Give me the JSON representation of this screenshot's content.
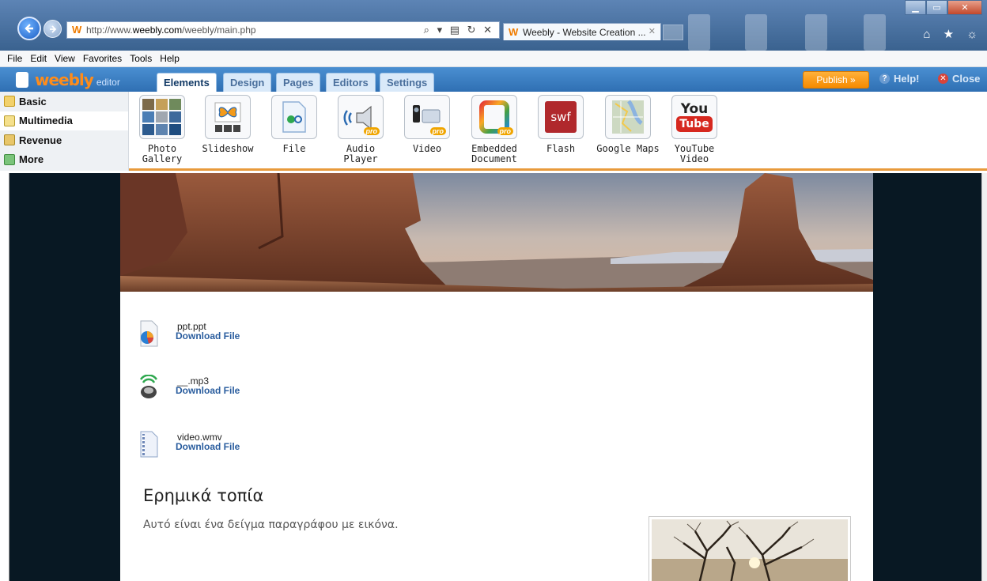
{
  "browser": {
    "url_prefix": "http://www.",
    "url_host": "weebly.com",
    "url_path": "/weebly/main.php",
    "address_tools": "⌕ ▾ ▤ ↻ ✕",
    "tab_title": "Weebly - Website Creation ...",
    "tab_close": "✕",
    "win_minimize": "▁",
    "win_maximize": "▭",
    "win_close": "✕",
    "chrome_icons": "⌂ ★ ☼"
  },
  "menubar": [
    "File",
    "Edit",
    "View",
    "Favorites",
    "Tools",
    "Help"
  ],
  "editor": {
    "logo": "weebly",
    "logo_sub": "editor",
    "tabs": [
      "Elements",
      "Design",
      "Pages",
      "Editors",
      "Settings"
    ],
    "publish": "Publish »",
    "help": "Help!",
    "close": "Close"
  },
  "categories": [
    "Basic",
    "Multimedia",
    "Revenue",
    "More"
  ],
  "elements": [
    {
      "label": "Photo\nGallery",
      "icon": "photo-gallery-icon"
    },
    {
      "label": "Slideshow",
      "icon": "slideshow-icon"
    },
    {
      "label": "File",
      "icon": "file-icon"
    },
    {
      "label": "Audio\nPlayer",
      "icon": "audio-player-icon",
      "pro": true
    },
    {
      "label": "Video",
      "icon": "video-icon",
      "pro": true
    },
    {
      "label": "Embedded\nDocument",
      "icon": "embedded-document-icon",
      "pro": true
    },
    {
      "label": "Flash",
      "icon": "flash-icon"
    },
    {
      "label": "Google Maps",
      "icon": "google-maps-icon"
    },
    {
      "label": "YouTube\nVideo",
      "icon": "youtube-icon"
    }
  ],
  "icon_text": {
    "pro": "pro",
    "swf": "swf",
    "you": "You",
    "tube": "Tube"
  },
  "files": [
    {
      "name": "ppt.ppt",
      "link": "Download File",
      "icon": "ppt-icon"
    },
    {
      "name": "__.mp3",
      "link": "Download File",
      "icon": "mp3-icon"
    },
    {
      "name": "video.wmv",
      "link": "Download File",
      "icon": "video-file-icon"
    }
  ],
  "content": {
    "heading": "Ερημικά τοπία",
    "paragraph": "Αυτό είναι ένα δείγμα παραγράφου με εικόνα."
  },
  "colors": {
    "accent_orange": "#f58a00",
    "editor_blue": "#2f6fb3",
    "canvas_bg": "#081823",
    "link_blue": "#2a5d9e"
  }
}
